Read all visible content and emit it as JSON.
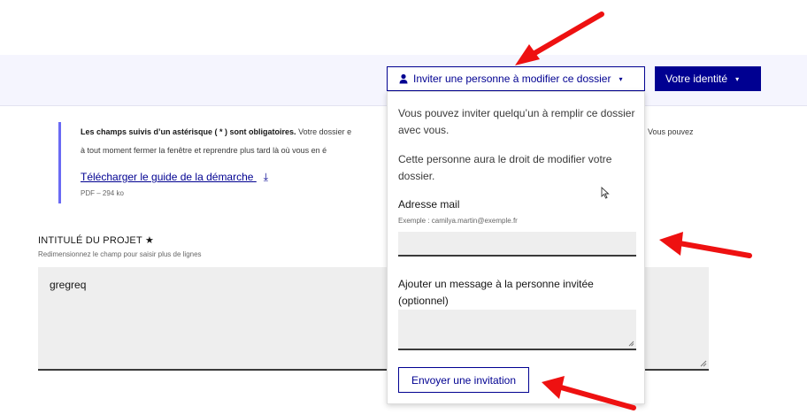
{
  "header": {
    "invite_button_label": "Inviter une personne à modifier ce dossier",
    "identity_button_label": "Votre identité",
    "chevron_glyph": "▾",
    "colors": {
      "primary": "#000091",
      "header_bg": "#f5f5fe"
    }
  },
  "notice": {
    "bold_text": "Les champs suivis d’un astérisque ( * ) sont obligatoires.",
    "line1_rest": " Votre dossier e",
    "line2": "à tout moment fermer la fenêtre et reprendre plus tard là où vous en é",
    "right_fragment": "Vous pouvez",
    "guide_link": "Télécharger le guide de la démarche",
    "download_glyph": "⤓",
    "guide_meta": "PDF – 294 ko"
  },
  "project": {
    "label": "INTITULÉ DU PROJET ★",
    "hint": "Redimensionnez le champ pour saisir plus de lignes",
    "value": "gregreq"
  },
  "invite_dropdown": {
    "intro_1": "Vous pouvez inviter quelqu’un à remplir ce dossier avec vous.",
    "intro_2": "Cette personne aura le droit de modifier votre dossier.",
    "email_label": "Adresse mail",
    "email_hint": "Exemple : camilya.martin@exemple.fr",
    "email_value": "",
    "message_label": "Ajouter un message à la personne invitée (optionnel)",
    "message_value": "",
    "send_button": "Envoyer une invitation"
  },
  "annotations": {
    "arrow_color": "#ee1111"
  }
}
